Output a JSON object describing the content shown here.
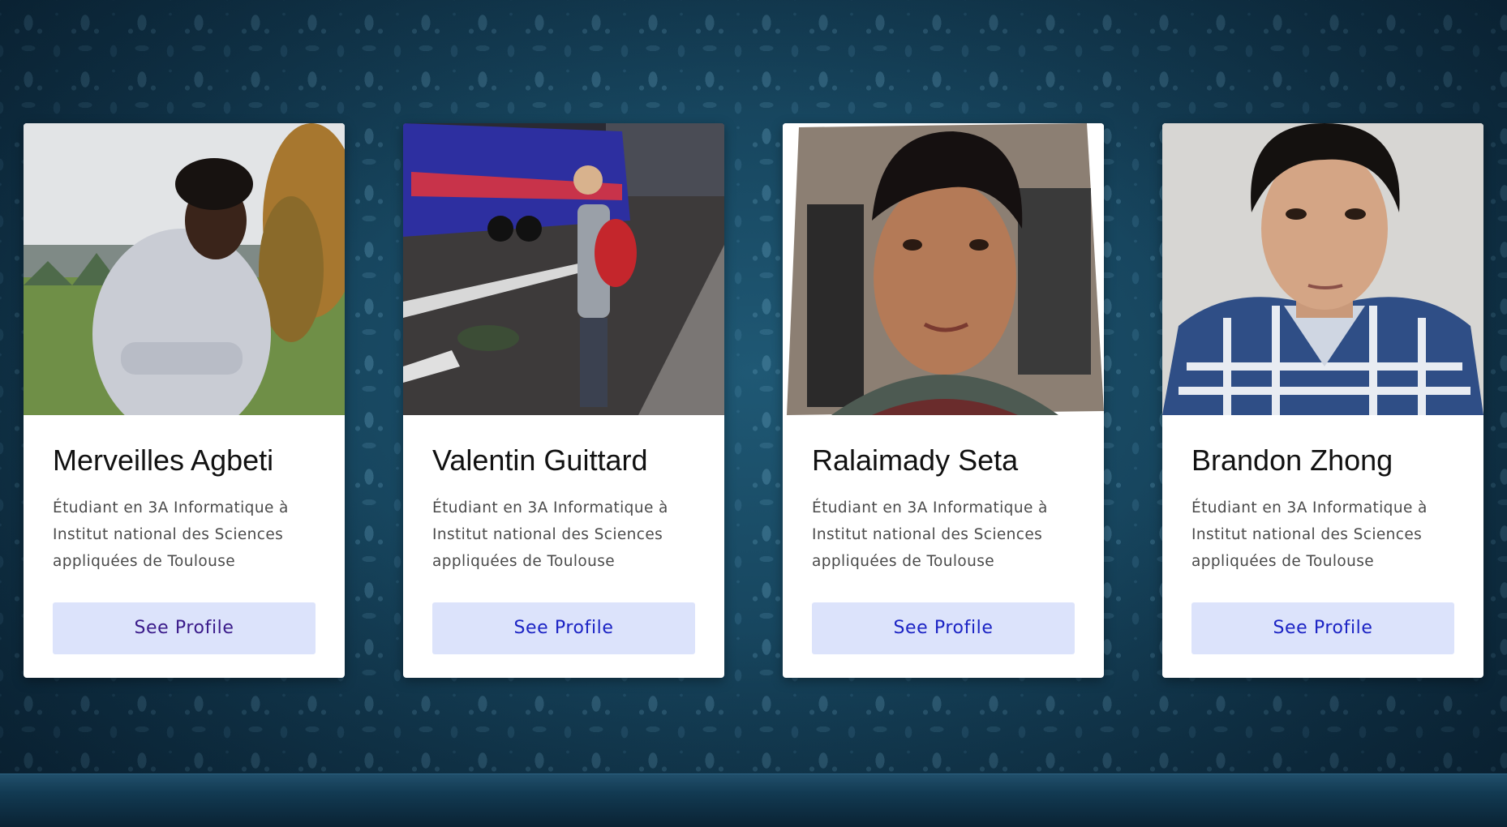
{
  "team": {
    "members": [
      {
        "name": "Merveilles Agbeti",
        "description": "Étudiant en 3A Informatique à Institut national des Sciences appliquées de Toulouse",
        "button_label": "See Profile"
      },
      {
        "name": "Valentin Guittard",
        "description": "Étudiant en 3A Informatique à Institut national des Sciences appliquées de Toulouse",
        "button_label": "See Profile"
      },
      {
        "name": "Ralaimady Seta",
        "description": "Étudiant en 3A Informatique à Institut national des Sciences appliquées de Toulouse",
        "button_label": "See Profile"
      },
      {
        "name": "Brandon Zhong",
        "description": "Étudiant en 3A Informatique à Institut national des Sciences appliquées de Toulouse",
        "button_label": "See Profile"
      }
    ]
  },
  "colors": {
    "background": "#123a52",
    "card": "#ffffff",
    "button_bg": "#dce3fb",
    "button_text": "#1b23c4",
    "button_text_visited": "#3a1a8a"
  }
}
